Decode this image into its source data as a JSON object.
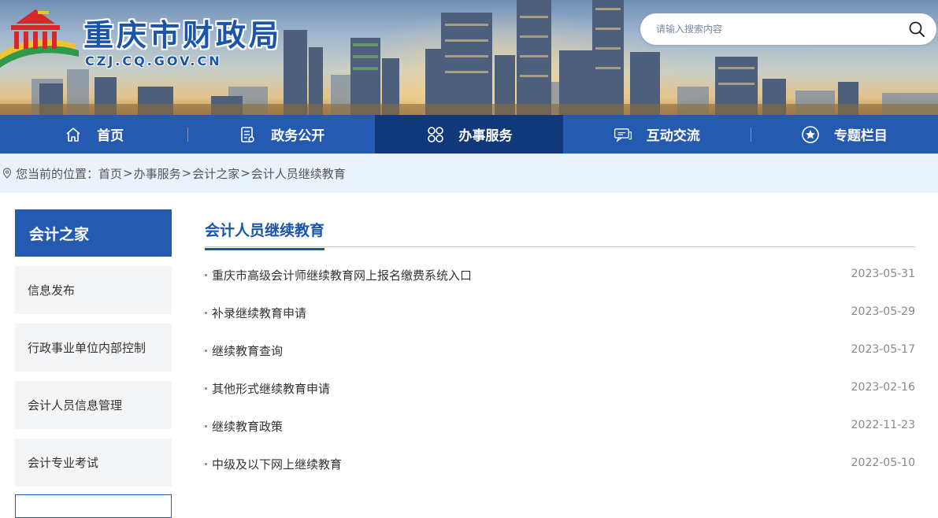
{
  "header": {
    "site_title": "重庆市财政局",
    "site_domain": "CZJ.CQ.GOV.CN",
    "search_placeholder": "请输入搜索内容"
  },
  "nav": {
    "items": [
      {
        "label": "首页",
        "icon": "home-icon"
      },
      {
        "label": "政务公开",
        "icon": "document-icon"
      },
      {
        "label": "办事服务",
        "icon": "grid-icon"
      },
      {
        "label": "互动交流",
        "icon": "chat-icon"
      },
      {
        "label": "专题栏目",
        "icon": "star-icon"
      }
    ],
    "active_index": 2
  },
  "breadcrumb": {
    "prefix": "您当前的位置：",
    "items": [
      "首页",
      "办事服务",
      "会计之家",
      "会计人员继续教育"
    ],
    "separator": ">"
  },
  "sidebar": {
    "heading": "会计之家",
    "items": [
      "信息发布",
      "行政事业单位内部控制",
      "会计人员信息管理",
      "会计专业考试"
    ]
  },
  "main": {
    "title": "会计人员继续教育",
    "list": [
      {
        "title": "重庆市高级会计师继续教育网上报名缴费系统入口",
        "date": "2023-05-31"
      },
      {
        "title": "补录继续教育申请",
        "date": "2023-05-29"
      },
      {
        "title": "继续教育查询",
        "date": "2023-05-17"
      },
      {
        "title": "其他形式继续教育申请",
        "date": "2023-02-16"
      },
      {
        "title": "继续教育政策",
        "date": "2022-11-23"
      },
      {
        "title": "中级及以下网上继续教育",
        "date": "2022-05-10"
      }
    ]
  },
  "colors": {
    "brand_blue": "#245bb0",
    "nav_active": "#11387a",
    "crumb_bg": "#eaf2fb"
  }
}
